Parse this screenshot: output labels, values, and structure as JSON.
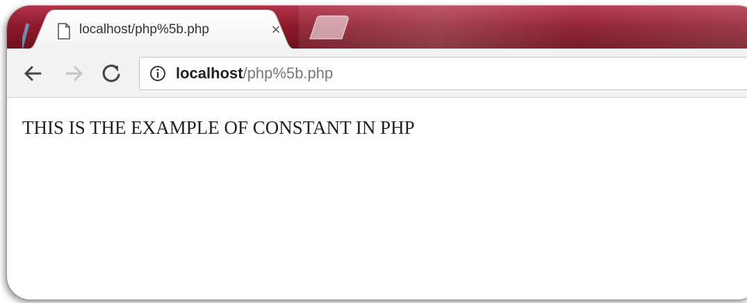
{
  "browser": {
    "tab": {
      "title": "localhost/php%5b.php",
      "close_glyph": "×",
      "favicon": "page-icon"
    },
    "toolbar": {
      "back_icon": "back-arrow-icon",
      "forward_icon": "forward-arrow-icon",
      "reload_icon": "reload-icon"
    },
    "address_bar": {
      "info_icon": "info-icon",
      "host": "localhost",
      "path": "/php%5b.php"
    },
    "colors": {
      "tabstrip": "#8f1b2c",
      "toolbar": "#f2f2f2"
    }
  },
  "page": {
    "text": "THIS IS THE EXAMPLE OF CONSTANT IN PHP"
  }
}
